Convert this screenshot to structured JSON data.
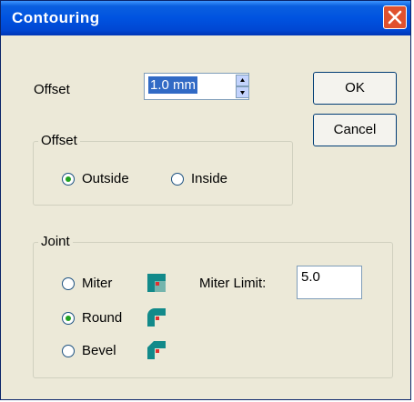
{
  "window": {
    "title": "Contouring"
  },
  "offset": {
    "label": "Offset",
    "value": "1.0 mm"
  },
  "buttons": {
    "ok": "OK",
    "cancel": "Cancel"
  },
  "offset_group": {
    "label": "Offset",
    "options": [
      {
        "label": "Outside",
        "checked": true
      },
      {
        "label": "Inside",
        "checked": false
      }
    ]
  },
  "joint_group": {
    "label": "Joint",
    "options": [
      {
        "label": "Miter",
        "checked": false,
        "icon": "miter-joint-icon"
      },
      {
        "label": "Round",
        "checked": true,
        "icon": "round-joint-icon"
      },
      {
        "label": "Bevel",
        "checked": false,
        "icon": "bevel-joint-icon"
      }
    ],
    "miter_limit": {
      "label": "Miter Limit:",
      "value": "5.0"
    }
  },
  "colors": {
    "title_bar": "#0054e3",
    "dialog_bg": "#ece9d8",
    "icon_teal": "#128a8a",
    "icon_red": "#e03030",
    "close_button": "#e0512e"
  }
}
